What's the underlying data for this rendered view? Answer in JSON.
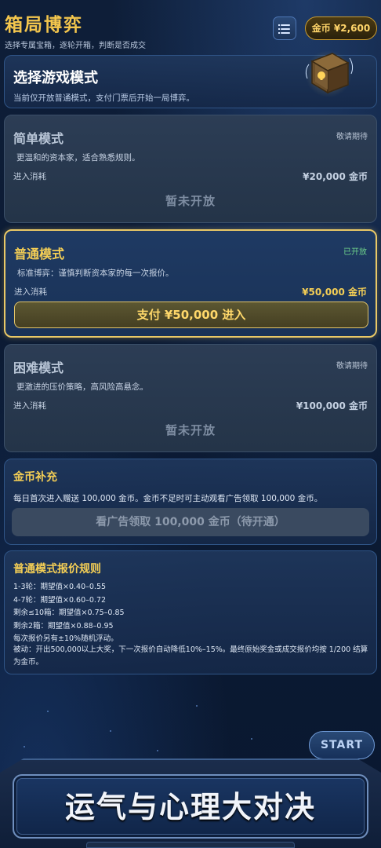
{
  "header": {
    "title": "箱局博弈",
    "subtitle": "选择专属宝箱，逐轮开箱，判断是否成交",
    "coin_balance": "金币 ¥2,600"
  },
  "intro": {
    "title": "选择游戏模式",
    "description": "当前仅开放普通模式，支付门票后开始一局博弈。"
  },
  "modes": [
    {
      "title": "简单模式",
      "status": "敬请期待",
      "description": "更温和的资本家，适合熟悉规则。",
      "cost_label": "进入消耗",
      "cost": "¥20,000 金币",
      "action": "暂未开放"
    },
    {
      "title": "普通模式",
      "status": "已开放",
      "description": "标准博弈：谨慎判断资本家的每一次报价。",
      "cost_label": "进入消耗",
      "cost": "¥50,000 金币",
      "action": "支付 ¥50,000 进入"
    },
    {
      "title": "困难模式",
      "status": "敬请期待",
      "description": "更激进的压价策略，高风险高悬念。",
      "cost_label": "进入消耗",
      "cost": "¥100,000 金币",
      "action": "暂未开放"
    }
  ],
  "supply": {
    "title": "金币补充",
    "description": "每日首次进入赠送 100,000 金币。金币不足时可主动观看广告领取 100,000 金币。",
    "ad_button": "看广告领取 100,000 金币（待开通）"
  },
  "rules": {
    "title": "普通模式报价规则",
    "lines": [
      "1-3轮：期望值×0.40–0.55",
      "4-7轮：期望值×0.60–0.72",
      "剩余≤10箱：期望值×0.75–0.85",
      "剩余2箱：期望值×0.88–0.95",
      "每次报价另有±10%随机浮动。"
    ],
    "passive": "被动：开出500,000以上大奖，下一次报价自动降低10%–15%。最终原始奖金或成交报价均按 1/200 结算为金币。"
  },
  "footer": {
    "start_button": "START",
    "banner": "运气与心理大对决"
  },
  "colors": {
    "accent_gold": "#f5cf55",
    "open_green": "#6fd38b",
    "background": "#0b1a33"
  }
}
